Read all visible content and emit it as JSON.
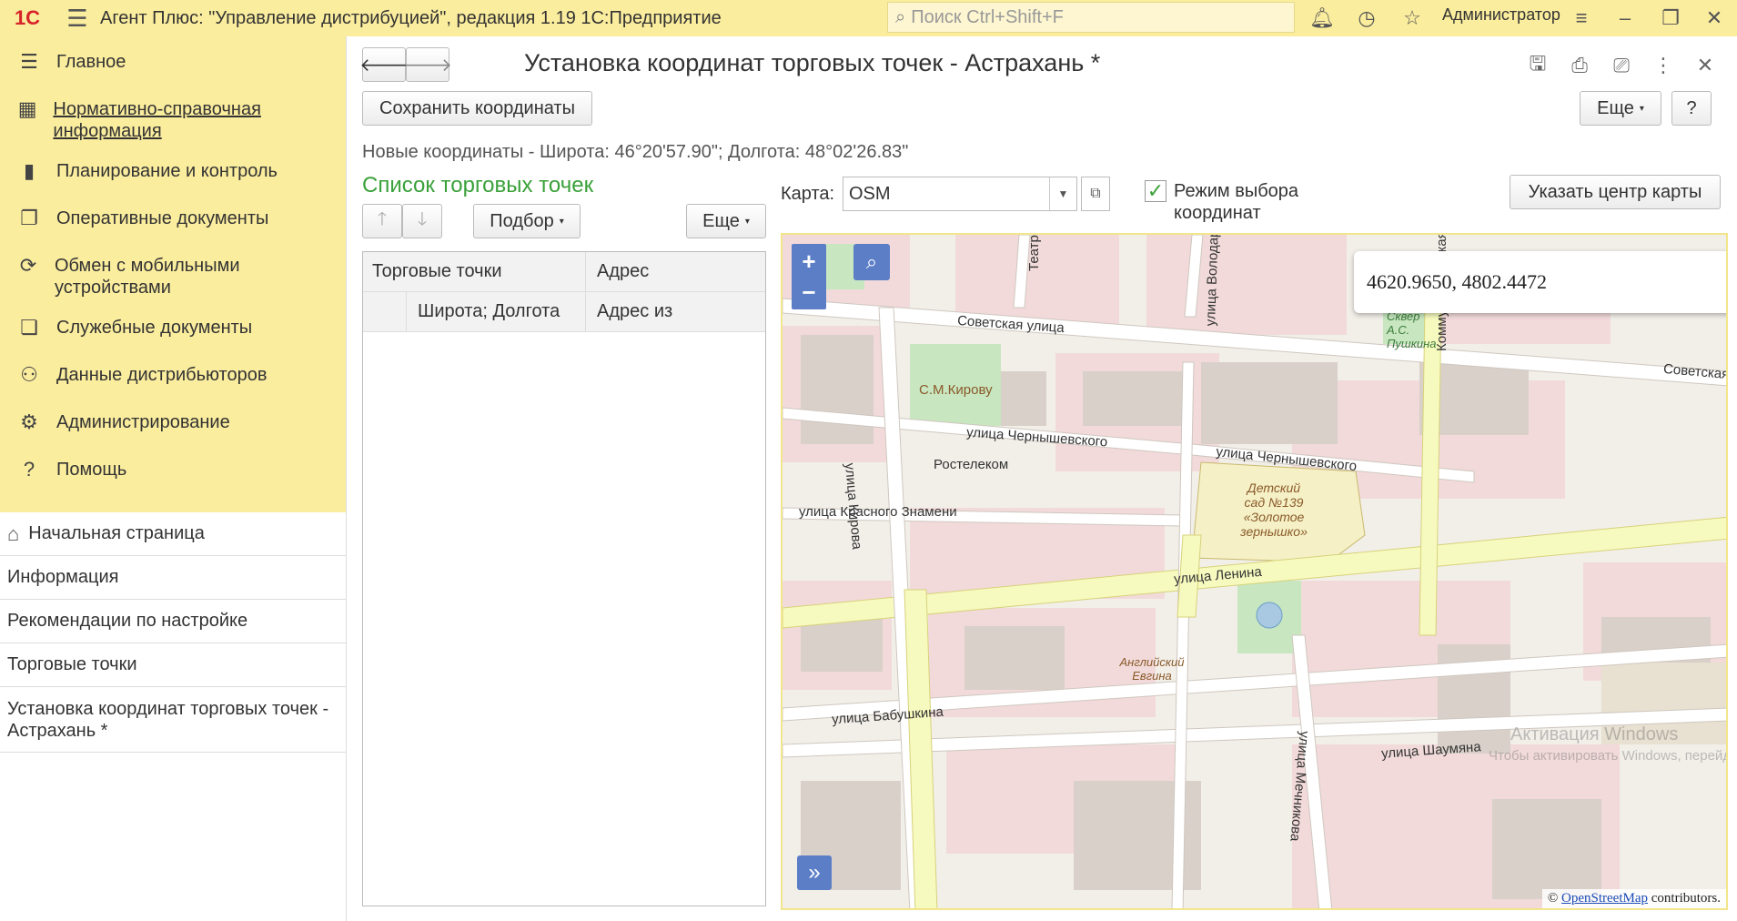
{
  "topbar": {
    "logo": "1С",
    "app_title": "Агент Плюс: \"Управление дистрибуцией\", редакция 1.19 1С:Предприятие",
    "search_placeholder": "Поиск Ctrl+Shift+F",
    "user": "Администратор"
  },
  "sidebar": {
    "sections": [
      {
        "label": "Главное",
        "icon": "menu-icon",
        "glyph": "☰"
      },
      {
        "label": "Нормативно-справочная информация",
        "icon": "catalog-icon",
        "glyph": "▦",
        "link": true
      },
      {
        "label": "Планирование и контроль",
        "icon": "bar-chart-icon",
        "glyph": "▮"
      },
      {
        "label": "Оперативные документы",
        "icon": "documents-icon",
        "glyph": "❐"
      },
      {
        "label": "Обмен с мобильными устройствами",
        "icon": "sync-icon",
        "glyph": "⟳"
      },
      {
        "label": "Служебные документы",
        "icon": "service-docs-icon",
        "glyph": "❏"
      },
      {
        "label": "Данные дистрибьюторов",
        "icon": "distributors-icon",
        "glyph": "⚇"
      },
      {
        "label": "Администрирование",
        "icon": "gear-icon",
        "glyph": "⚙"
      },
      {
        "label": "Помощь",
        "icon": "help-icon",
        "glyph": "?"
      }
    ],
    "nav": [
      {
        "label": "Начальная страница",
        "home": true
      },
      {
        "label": "Информация"
      },
      {
        "label": "Рекомендации по настройке"
      },
      {
        "label": "Торговые точки"
      },
      {
        "label": "Установка координат торговых точек - Астрахань *",
        "active": true
      }
    ]
  },
  "main": {
    "title": "Установка координат торговых точек - Астрахань *",
    "save_button": "Сохранить координаты",
    "more_button": "Еще",
    "help_button": "?",
    "new_coords": "Новые координаты - Широта: 46°20'57.90\"; Долгота: 48°02'26.83\"",
    "list_title": "Список торговых точек",
    "pick_button": "Подбор",
    "list_more_button": "Еще",
    "table": {
      "headers": [
        "Торговые точки",
        "Адрес"
      ],
      "subheaders": [
        "Широта; Долгота",
        "Адрес из"
      ]
    },
    "map_label": "Карта:",
    "map_value": "OSM",
    "coord_mode_checked": true,
    "coord_mode_label": "Режим выбора координат",
    "center_button": "Указать центр карты"
  },
  "map": {
    "popup": "4620.9650, 4802.4472",
    "zoom_in": "+",
    "zoom_out": "−",
    "expand": "»",
    "attribution_prefix": "© ",
    "attribution_link": "OpenStreetMap",
    "attribution_suffix": " contributors.",
    "labels": [
      "Советская улица",
      "улица Чернышевского",
      "улица Чернышевского",
      "улица Красного Знамени",
      "улица Ленина",
      "улица Бабушкина",
      "улица Кирова",
      "улица Володарского",
      "Советская",
      "Ростелеком",
      "С.М.Кирову",
      "Детский сад №139 «Золотое зернышко»",
      "Сквер А.С. Пушкина",
      "улица Шаумяна",
      "Английский Евгина",
      "Театра",
      "Коммунистическая",
      "улица Мечникова"
    ],
    "watermark": "Активация Windows",
    "watermark2": "Чтобы активировать Windows, перейдите в раздел Параметры"
  }
}
